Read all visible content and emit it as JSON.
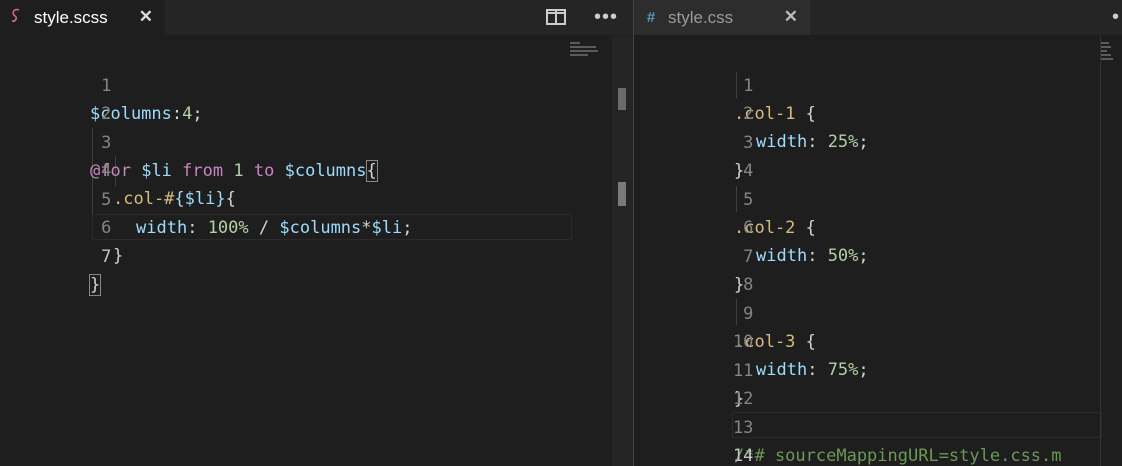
{
  "left_editor": {
    "tab": {
      "icon": "sass-icon",
      "label": "style.scss",
      "close": "✕"
    },
    "toolbar": {
      "split_icon": "split-editor-icon",
      "more_icon": "more-actions-icon"
    },
    "lines": [
      {
        "num": "1"
      },
      {
        "num": "2"
      },
      {
        "num": "3"
      },
      {
        "num": "4"
      },
      {
        "num": "5"
      },
      {
        "num": "6"
      },
      {
        "num": "7"
      }
    ],
    "code": {
      "l1_var": "$columns",
      "l1_colon": ":",
      "l1_num": "4",
      "l1_semi": ";",
      "l3_at": "@for",
      "l3_var": "$li",
      "l3_from": "from",
      "l3_num": "1",
      "l3_to": "to",
      "l3_var2": "$columns",
      "l3_brace": "{",
      "l4_sel": ".col-#",
      "l4_interp": "{$li}",
      "l4_brace": "{",
      "l5_prop": "width",
      "l5_colon": ":",
      "l5_num": "100%",
      "l5_op": "/",
      "l5_var": "$columns",
      "l5_star": "*",
      "l5_var2": "$li",
      "l5_semi": ";",
      "l6_brace": "}",
      "l7_brace": "}"
    },
    "current_line": "7"
  },
  "right_editor": {
    "tab": {
      "icon": "css-hash-icon",
      "icon_glyph": "#",
      "label": "style.css",
      "close": "✕"
    },
    "lines": [
      {
        "num": "1"
      },
      {
        "num": "2"
      },
      {
        "num": "3"
      },
      {
        "num": "4"
      },
      {
        "num": "5"
      },
      {
        "num": "6"
      },
      {
        "num": "7"
      },
      {
        "num": "8"
      },
      {
        "num": "9"
      },
      {
        "num": "10"
      },
      {
        "num": "11"
      },
      {
        "num": "12"
      },
      {
        "num": "13"
      },
      {
        "num": "14"
      }
    ],
    "code": {
      "l1_sel": ".col-1",
      "l1_brace": "{",
      "l2_prop": "width",
      "l2_colon": ":",
      "l2_num": "25%",
      "l2_semi": ";",
      "l3_brace": "}",
      "l5_sel": ".col-2",
      "l5_brace": "{",
      "l6_prop": "width",
      "l6_colon": ":",
      "l6_num": "50%",
      "l6_semi": ";",
      "l7_brace": "}",
      "l9_sel": ".col-3",
      "l9_brace": "{",
      "l10_prop": "width",
      "l10_colon": ":",
      "l10_num": "75%",
      "l10_semi": ";",
      "l11_brace": "}",
      "l13_comment": "/*# sourceMappingURL=style.css.m"
    },
    "current_line": "14"
  }
}
